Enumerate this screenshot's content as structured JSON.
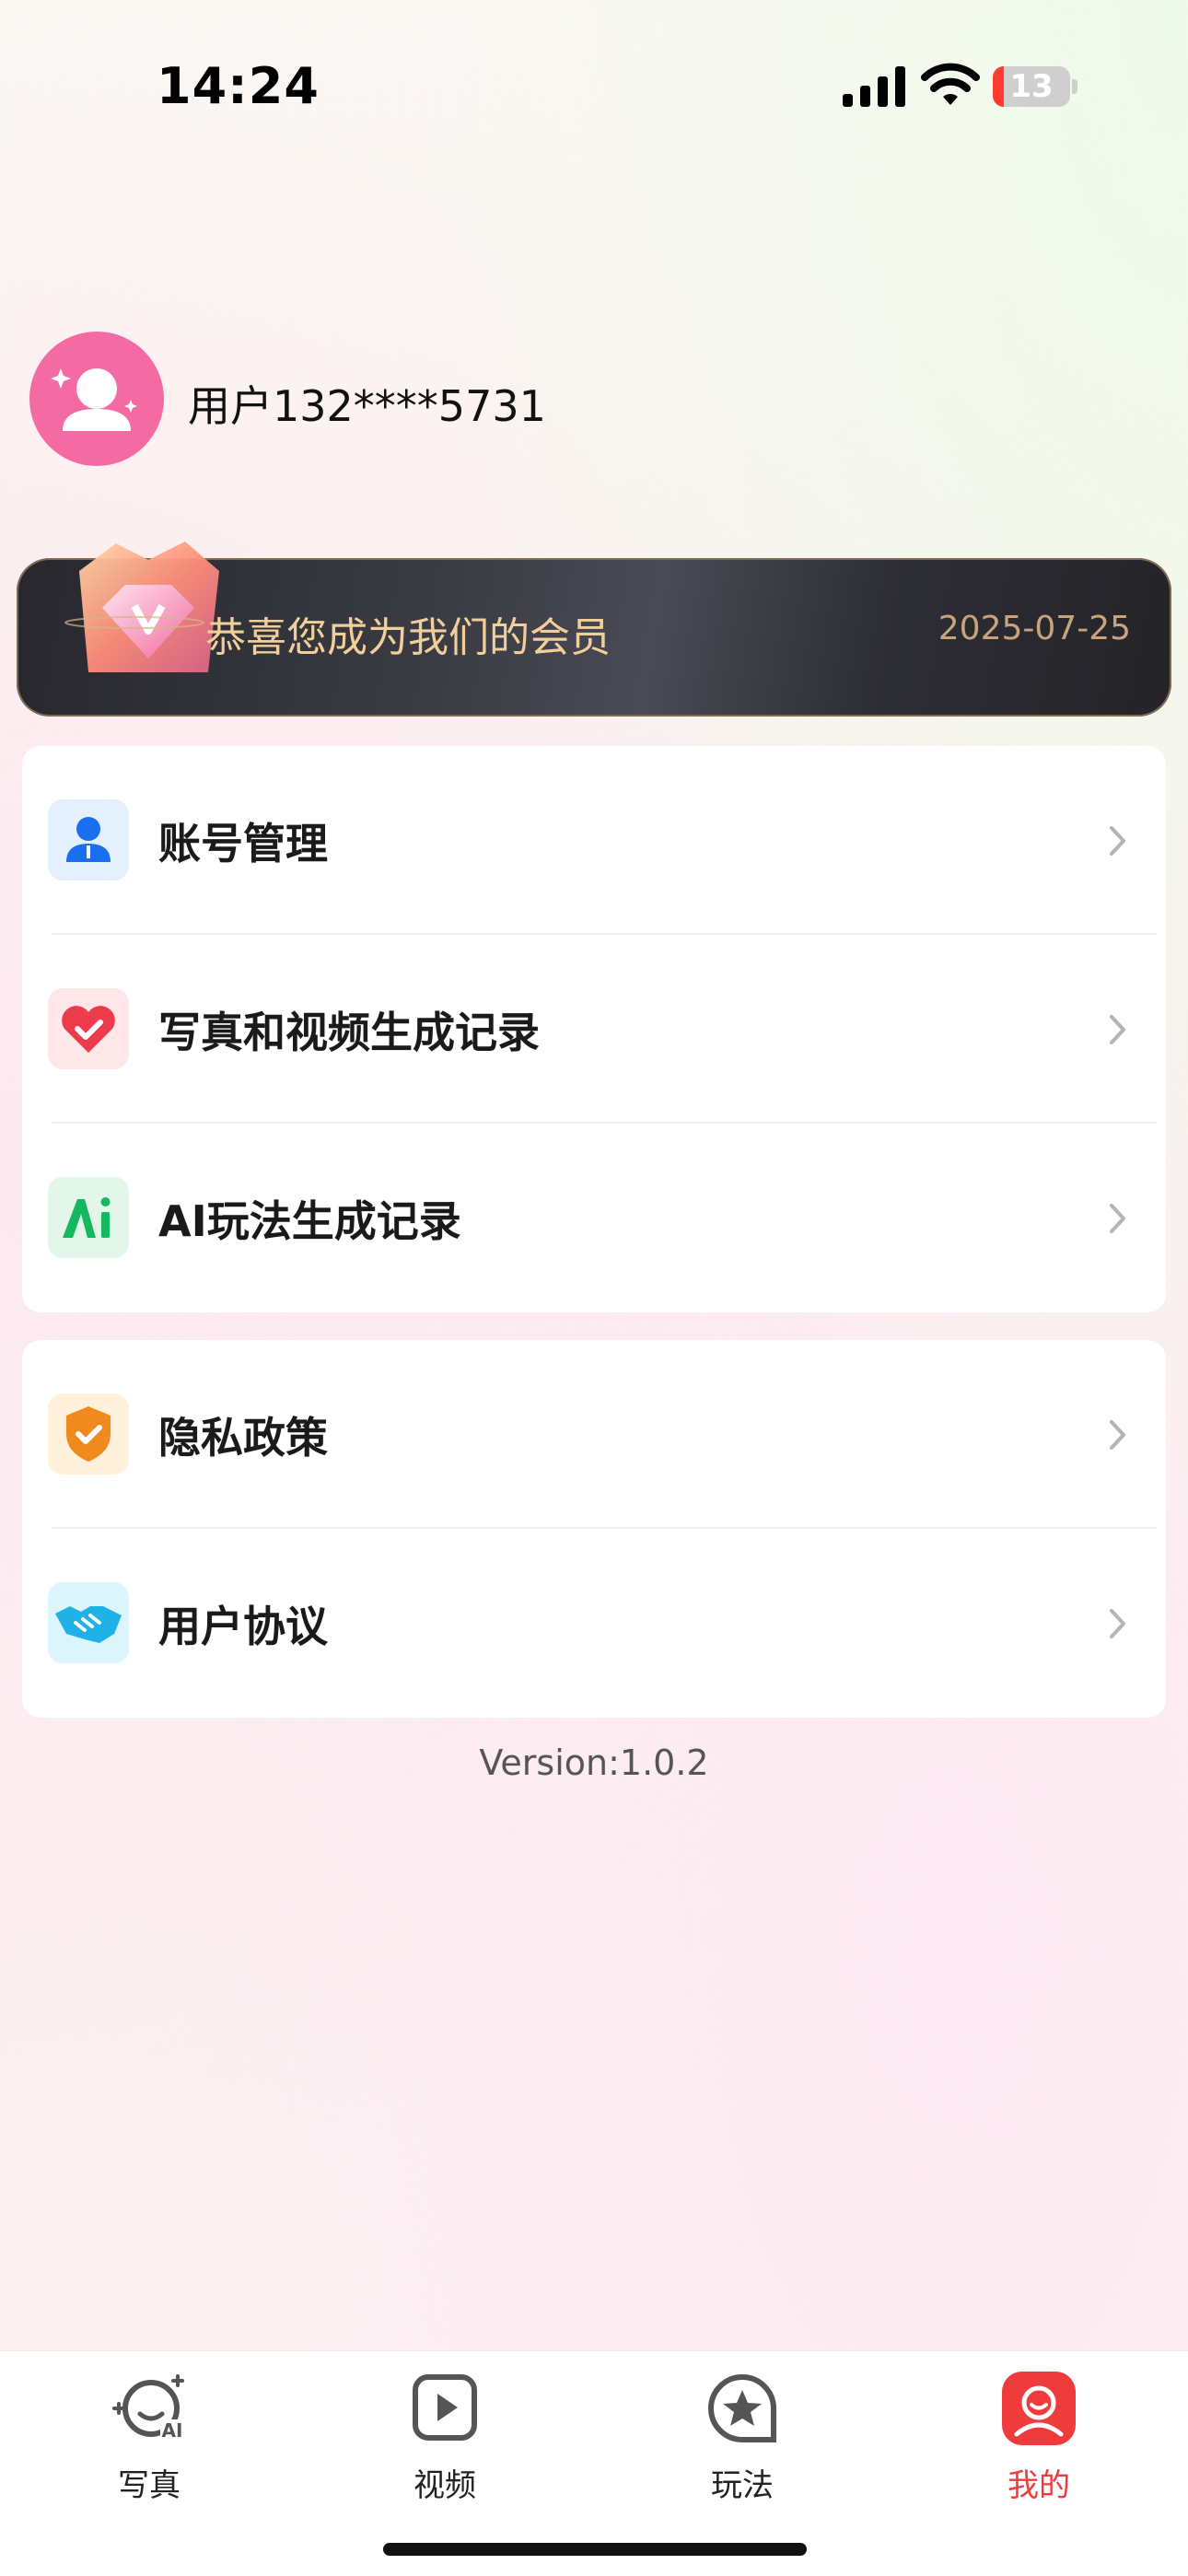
{
  "status_bar": {
    "time": "14:24",
    "battery_level": "13",
    "battery_fraction": 0.13
  },
  "profile": {
    "username": "用户132****5731"
  },
  "vip_banner": {
    "text": "恭喜您成为我们的会员",
    "date": "2025-07-25"
  },
  "menu_group1": [
    {
      "label": "账号管理",
      "icon": "user-icon",
      "color": "#1a6ff0"
    },
    {
      "label": "写真和视频生成记录",
      "icon": "heart-icon",
      "color": "#ee3b4b"
    },
    {
      "label": "AI玩法生成记录",
      "icon": "ai-icon",
      "color": "#13b85f"
    }
  ],
  "menu_group2": [
    {
      "label": "隐私政策",
      "icon": "shield-icon",
      "color": "#f08a1c"
    },
    {
      "label": "用户协议",
      "icon": "handshake-icon",
      "color": "#1eb2e6"
    }
  ],
  "version": "Version:1.0.2",
  "tabs": [
    {
      "label": "写真",
      "icon": "portrait-ai-icon",
      "active": false
    },
    {
      "label": "视频",
      "icon": "video-play-icon",
      "active": false
    },
    {
      "label": "玩法",
      "icon": "star-icon",
      "active": false
    },
    {
      "label": "我的",
      "icon": "profile-icon",
      "active": true
    }
  ],
  "colors": {
    "accent": "#ef3b3b",
    "avatar": "#f46aa3",
    "vip_text": "#f1cf9a"
  }
}
